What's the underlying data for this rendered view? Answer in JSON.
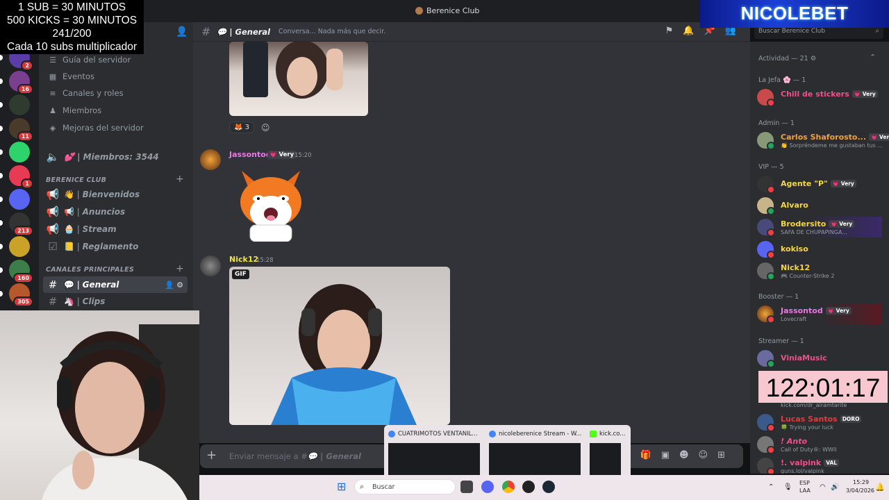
{
  "overlay": {
    "line1": "1 SUB    = 30 MINUTOS",
    "line2": "500 KICKS = 30 MINUTOS",
    "line3": "241/200",
    "line4": "Cada 10 subs multiplicador",
    "brand": "NICOLEBET",
    "timer": "122:01:17"
  },
  "window": {
    "title": "Berenice Club"
  },
  "servers": [
    {
      "badge": "2",
      "color": "#5b3ca8"
    },
    {
      "badge": "16",
      "color": "#7a3f8f"
    },
    {
      "badge": "",
      "color": "#2e3b2e"
    },
    {
      "badge": "11",
      "color": "#4a3a2a"
    },
    {
      "badge": "",
      "color": "#2ed36b"
    },
    {
      "badge": "1",
      "color": "#e83a53"
    },
    {
      "badge": "",
      "color": "#5865f2"
    },
    {
      "badge": "213",
      "color": "#333333"
    },
    {
      "badge": "",
      "color": "#c9a227"
    },
    {
      "badge": "160",
      "color": "#3c7d4a"
    },
    {
      "badge": "305",
      "color": "#b5582c"
    }
  ],
  "sidebar": {
    "nav": [
      {
        "icon": "☰",
        "label": "Guía del servidor"
      },
      {
        "icon": "▦",
        "label": "Eventos"
      },
      {
        "icon": "≡",
        "label": "Canales y roles"
      },
      {
        "icon": "♟",
        "label": "Miembros"
      },
      {
        "icon": "◈",
        "label": "Mejoras del servidor"
      }
    ],
    "members_channel": "💕 | Miembros: 3544",
    "category1": "BERENICE CLUB",
    "category1_channels": [
      {
        "emoji": "👋",
        "label": "Bienvenidos"
      },
      {
        "emoji": "📢",
        "label": "Anuncios"
      },
      {
        "emoji": "🧁",
        "label": "Stream"
      },
      {
        "emoji": "📒",
        "label": "Reglamento"
      }
    ],
    "category2": "CANALES PRINCIPALES",
    "category2_channels": [
      {
        "emoji": "💬",
        "label": "General"
      },
      {
        "emoji": "🦄",
        "label": "Clips"
      }
    ]
  },
  "chat": {
    "channel_name": "💬 | General",
    "topic": "Conversa... Nada más que decir.",
    "reaction_count": "3",
    "messages": [
      {
        "author": "Jassontod",
        "tag": "💗 Very",
        "time": "15:20",
        "color": "#e978e5"
      },
      {
        "author": "Nick12",
        "tag": "",
        "time": "15:28",
        "color": "#f0e443"
      }
    ],
    "gif_label": "GIF",
    "composer_placeholder_prefix": "Enviar mensaje a #",
    "composer_placeholder_channel": "💬 | General"
  },
  "members": {
    "search_placeholder": "Buscar Berenice Club",
    "activity": "Actividad — 21 ⚙",
    "groups": [
      {
        "title": "La Jefa 🌸 — 1",
        "items": [
          {
            "name": "Chill de stickers",
            "tag": "💗 Very",
            "sub": "",
            "color": "#f04f8d"
          }
        ]
      },
      {
        "title": "Admin — 1",
        "items": [
          {
            "name": "Carlos Shaforosto...",
            "tag": "💗 Very",
            "sub": "👏 Sorpréndeme me gustaban tus ...",
            "color": "#f0a33c"
          }
        ]
      },
      {
        "title": "VIP — 5",
        "items": [
          {
            "name": "Agente \"P\"",
            "tag": "💗 Very",
            "sub": "",
            "color": "#f5d744"
          },
          {
            "name": "Alvaro",
            "tag": "",
            "sub": "",
            "color": "#f5d744"
          },
          {
            "name": "Brodersito",
            "tag": "💗 Very",
            "sub": "SAFA DE CHUPAPINGA...",
            "color": "#f5d744"
          },
          {
            "name": "kokiso",
            "tag": "",
            "sub": "",
            "color": "#f5d744"
          },
          {
            "name": "Nick12",
            "tag": "",
            "sub": "🎮 Counter-Strike 2",
            "color": "#f5d744"
          }
        ]
      },
      {
        "title": "Booster — 1",
        "items": [
          {
            "name": "Jassontod",
            "tag": "💗 Very",
            "sub": "Lovecraft",
            "color": "#e978e5"
          }
        ]
      },
      {
        "title": "Streamer — 1",
        "items": [
          {
            "name": "ViniaMusic",
            "tag": "",
            "sub": "",
            "color": "#f04f8d"
          }
        ]
      }
    ],
    "more": [
      {
        "name": "",
        "sub": "kick.com/dr_airamtarite",
        "color": "#f04f8d"
      },
      {
        "name": "Lucas Santos",
        "tag": "DORO",
        "sub": "🍀 Trying your luck",
        "color": "#e23b3b"
      },
      {
        "name": "! Anto",
        "tag": "",
        "sub": "Call of Duty®: WWII",
        "color": "#f04f8d"
      },
      {
        "name": "!. valpink",
        "tag": "VAL",
        "sub": "guns.lol/valpink",
        "color": "#f04f8d"
      }
    ]
  },
  "taskbar": {
    "search_placeholder": "Buscar",
    "thumbs": [
      {
        "title": "CUATRIMOTOS VENTANIL...",
        "color": "#4285f4"
      },
      {
        "title": "nicoleberenice Stream - W...",
        "color": "#4285f4"
      },
      {
        "title": "kick.co...",
        "color": "#53fc18"
      }
    ],
    "lang1": "ESP",
    "lang2": "LAA",
    "time": "15:29",
    "date": "3/04/2026"
  }
}
